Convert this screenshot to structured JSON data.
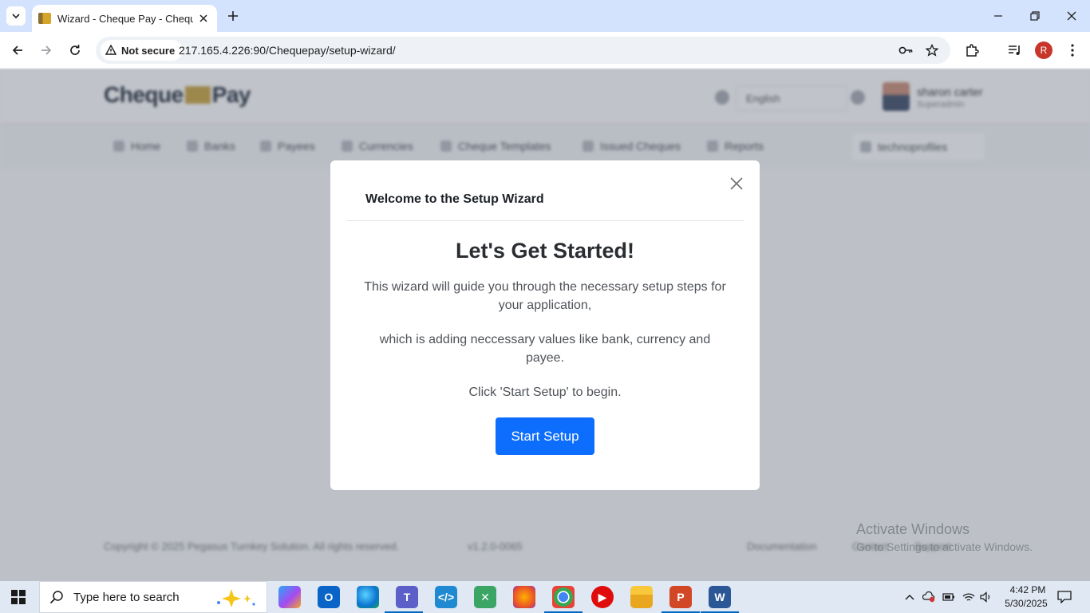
{
  "browser": {
    "tab_title": "Wizard - Cheque Pay - Cheque",
    "security_label": "Not secure",
    "url": "217.165.4.226:90/Chequepay/setup-wizard/",
    "profile_initial": "R"
  },
  "app": {
    "logo_left": "Cheque",
    "logo_right": "Pay",
    "language": "English",
    "user_name": "sharon carter",
    "user_role": "Superadmin",
    "menu": [
      "Home",
      "Banks",
      "Payees",
      "Currencies",
      "Cheque Templates",
      "Issued Cheques",
      "Reports"
    ],
    "menu_user": "technoprofiles",
    "footer_copyright": "Copyright © 2025 Pegasus Turnkey Solution. All rights reserved.",
    "footer_version": "v1.2.0-0065",
    "footer_links": [
      "Documentation",
      "Contact",
      "Support"
    ]
  },
  "modal": {
    "title": "Welcome to the Setup Wizard",
    "heading": "Let's Get Started!",
    "para1": "This wizard will guide you through the necessary setup steps for your application,",
    "para2": "which is adding neccessary values like bank, currency and payee.",
    "para3": "Click 'Start Setup' to begin.",
    "button_label": "Start Setup"
  },
  "watermark": {
    "title": "Activate Windows",
    "subtitle": "Go to Settings to activate Windows."
  },
  "taskbar": {
    "search_placeholder": "Type here to search",
    "time": "4:42 PM",
    "date": "5/30/2025"
  },
  "colors": {
    "primary_button": "#0d6efd",
    "tab_bar": "#d3e3fd",
    "taskbar": "#dfe8f3"
  }
}
